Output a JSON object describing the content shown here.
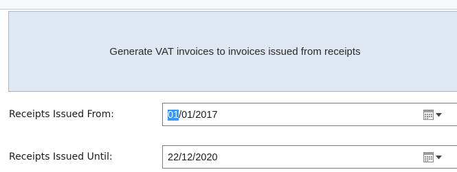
{
  "banner": {
    "text": "Generate VAT invoices to invoices issued from receipts"
  },
  "fields": {
    "from": {
      "label": "Receipts Issued From:",
      "value_selected": "01",
      "value_rest": "/01/2017"
    },
    "until": {
      "label": "Receipts Issued Until:",
      "value": "22/12/2020"
    }
  },
  "icons": {
    "calendar": "calendar-icon",
    "dropdown": "chevron-down-icon"
  },
  "colors": {
    "banner_bg": "#dfe7f2",
    "selection": "#3399ff"
  }
}
